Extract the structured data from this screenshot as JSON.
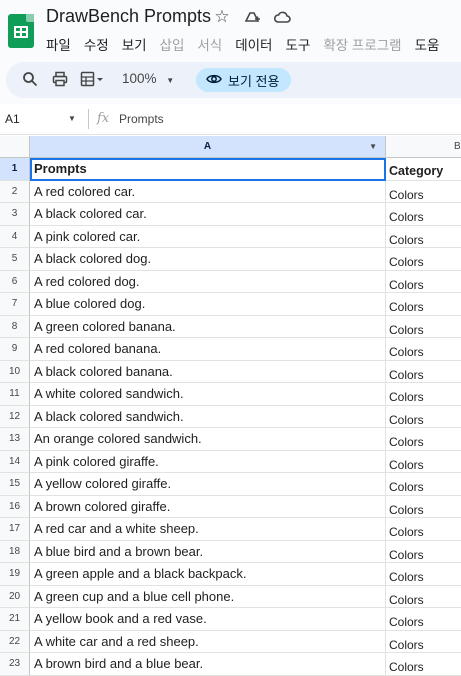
{
  "app": {
    "title": "DrawBench Prompts",
    "brand_color": "#0f9d58",
    "accent_color": "#1a73e8"
  },
  "menu": [
    "파일",
    "수정",
    "보기",
    "삽입",
    "서식",
    "데이터",
    "도구",
    "확장 프로그램",
    "도움"
  ],
  "toolbar": {
    "zoom": "100%",
    "view_only": "보기 전용"
  },
  "formula_bar": {
    "cell_ref": "A1",
    "content": "Prompts"
  },
  "grid": {
    "columns": [
      "A",
      "B"
    ],
    "header": {
      "row": "1",
      "a": "Prompts",
      "b": "Category"
    },
    "rows": [
      {
        "n": "2",
        "a": "A red colored car.",
        "b": "Colors"
      },
      {
        "n": "3",
        "a": "A black colored car.",
        "b": "Colors"
      },
      {
        "n": "4",
        "a": "A pink colored car.",
        "b": "Colors"
      },
      {
        "n": "5",
        "a": "A black colored dog.",
        "b": "Colors"
      },
      {
        "n": "6",
        "a": "A red colored dog.",
        "b": "Colors"
      },
      {
        "n": "7",
        "a": "A blue colored dog.",
        "b": "Colors"
      },
      {
        "n": "8",
        "a": "A green colored banana.",
        "b": "Colors"
      },
      {
        "n": "9",
        "a": "A red colored banana.",
        "b": "Colors"
      },
      {
        "n": "10",
        "a": "A black colored banana.",
        "b": "Colors"
      },
      {
        "n": "11",
        "a": "A white colored sandwich.",
        "b": "Colors"
      },
      {
        "n": "12",
        "a": "A black colored sandwich.",
        "b": "Colors"
      },
      {
        "n": "13",
        "a": "An orange colored sandwich.",
        "b": "Colors"
      },
      {
        "n": "14",
        "a": "A pink colored giraffe.",
        "b": "Colors"
      },
      {
        "n": "15",
        "a": "A yellow colored giraffe.",
        "b": "Colors"
      },
      {
        "n": "16",
        "a": "A brown colored giraffe.",
        "b": "Colors"
      },
      {
        "n": "17",
        "a": "A red car and a white sheep.",
        "b": "Colors"
      },
      {
        "n": "18",
        "a": "A blue bird and a brown bear.",
        "b": "Colors"
      },
      {
        "n": "19",
        "a": "A green apple and a black backpack.",
        "b": "Colors"
      },
      {
        "n": "20",
        "a": "A green cup and a blue cell phone.",
        "b": "Colors"
      },
      {
        "n": "21",
        "a": "A yellow book and a red vase.",
        "b": "Colors"
      },
      {
        "n": "22",
        "a": "A white car and a red sheep.",
        "b": "Colors"
      },
      {
        "n": "23",
        "a": "A brown bird and a blue bear.",
        "b": "Colors"
      }
    ]
  }
}
